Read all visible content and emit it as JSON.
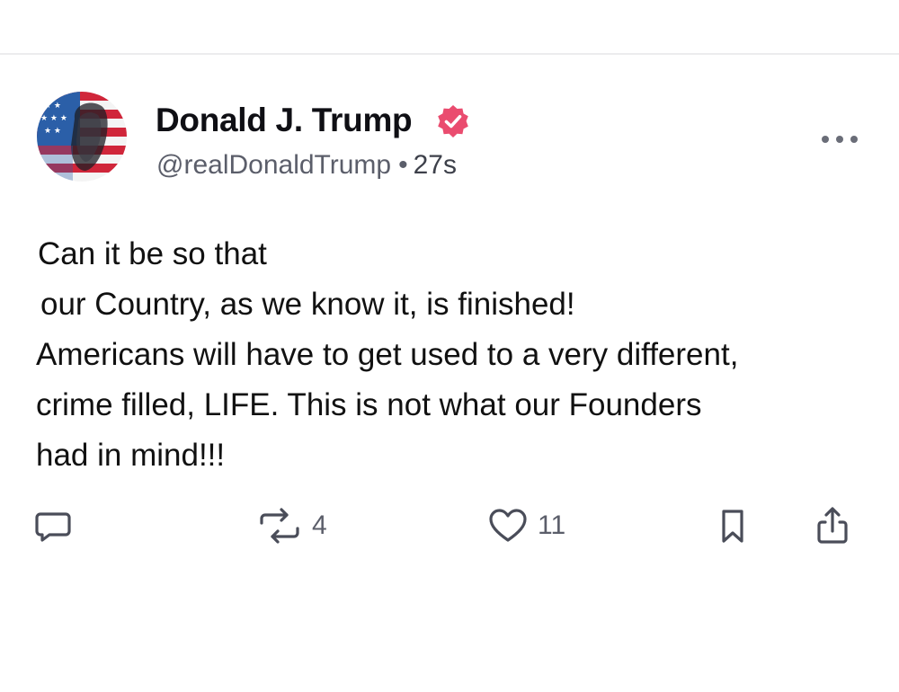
{
  "author": {
    "display_name": "Donald J. Trump",
    "handle": "@realDonaldTrump",
    "separator": "•",
    "timestamp": "27s",
    "verified": true,
    "verified_color": "#ea4c6f"
  },
  "post": {
    "lines": [
      "Can it be so that",
      "our Country, as we know it, is finished!",
      "Americans will have to get used to a very different,",
      "crime filled, LIFE. This is not what our Founders",
      "had in mind!!!"
    ]
  },
  "actions": {
    "reply": {
      "icon": "reply-icon"
    },
    "repost": {
      "icon": "repost-icon",
      "count": "4"
    },
    "like": {
      "icon": "heart-icon",
      "count": "11"
    },
    "bookmark": {
      "icon": "bookmark-icon"
    },
    "share": {
      "icon": "share-icon"
    }
  },
  "menu": {
    "icon": "more-options-icon"
  },
  "colors": {
    "text": "#0f0f14",
    "muted": "#5b5e6a",
    "icon": "#4a4d59"
  }
}
